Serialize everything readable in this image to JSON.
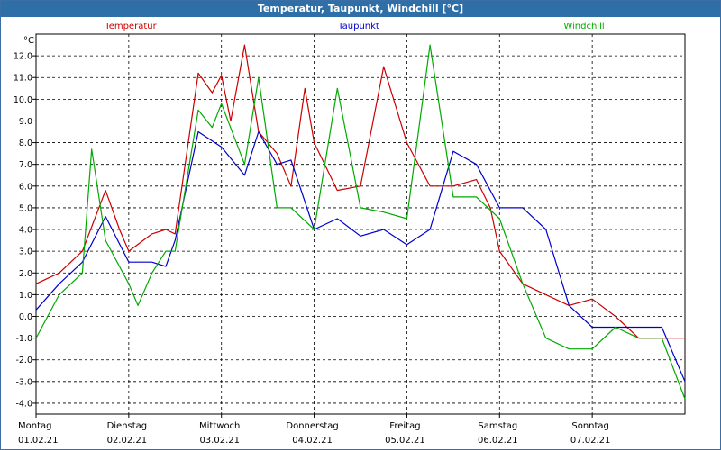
{
  "window": {
    "title": "Temperatur, Taupunkt, Windchill [°C]"
  },
  "chart_data": {
    "type": "line",
    "title": "Temperatur, Taupunkt, Windchill [°C]",
    "ylabel": "°C",
    "xlabel": "",
    "ylim": [
      -4.5,
      13.0
    ],
    "yticks": [
      -4.0,
      -3.0,
      -2.0,
      -1.0,
      0.0,
      1.0,
      2.0,
      3.0,
      4.0,
      5.0,
      6.0,
      7.0,
      8.0,
      9.0,
      10.0,
      11.0,
      12.0
    ],
    "ytick_labels": [
      "-4.0",
      "-3.0",
      "-2.0",
      "-1.0",
      "0.0",
      "1.0",
      "2.0",
      "3.0",
      "4.0",
      "5.0",
      "6.0",
      "7.0",
      "8.0",
      "9.0",
      "10.0",
      "11.0",
      "12.0"
    ],
    "grid": true,
    "x_range_days": [
      0,
      7
    ],
    "day_labels": [
      {
        "day": "Montag",
        "date": "01.02.21"
      },
      {
        "day": "Dienstag",
        "date": "02.02.21"
      },
      {
        "day": "Mittwoch",
        "date": "03.02.21"
      },
      {
        "day": "Donnerstag",
        "date": "04.02.21"
      },
      {
        "day": "Freitag",
        "date": "05.02.21"
      },
      {
        "day": "Samstag",
        "date": "06.02.21"
      },
      {
        "day": "Sonntag",
        "date": "07.02.21"
      }
    ],
    "legend_placement": "top",
    "series": [
      {
        "name": "Temperatur",
        "color": "#cc0000",
        "x": [
          0,
          0.25,
          0.5,
          0.75,
          0.9,
          1.0,
          1.25,
          1.4,
          1.5,
          1.75,
          1.9,
          2.0,
          2.1,
          2.25,
          2.4,
          2.6,
          2.75,
          2.9,
          3.0,
          3.25,
          3.5,
          3.75,
          4.0,
          4.25,
          4.5,
          4.75,
          4.9,
          5.0,
          5.25,
          5.5,
          5.75,
          6.0,
          6.25,
          6.5,
          6.75,
          7.0
        ],
        "values": [
          1.5,
          2.0,
          3.0,
          5.8,
          4.0,
          3.0,
          3.8,
          4.0,
          3.8,
          11.2,
          10.3,
          11.1,
          9.0,
          12.5,
          8.5,
          7.5,
          6.0,
          10.5,
          8.0,
          5.8,
          6.0,
          11.5,
          8.0,
          6.0,
          6.0,
          6.3,
          5.0,
          3.0,
          1.5,
          1.0,
          0.5,
          0.8,
          0.0,
          -1.0,
          -1.0,
          -1.0
        ]
      },
      {
        "name": "Taupunkt",
        "color": "#0000cc",
        "x": [
          0,
          0.25,
          0.5,
          0.75,
          1.0,
          1.25,
          1.4,
          1.5,
          1.75,
          2.0,
          2.25,
          2.4,
          2.6,
          2.75,
          3.0,
          3.25,
          3.5,
          3.75,
          4.0,
          4.25,
          4.5,
          4.75,
          5.0,
          5.25,
          5.5,
          5.75,
          6.0,
          6.25,
          6.5,
          6.75,
          7.0
        ],
        "values": [
          0.3,
          1.5,
          2.5,
          4.6,
          2.5,
          2.5,
          2.3,
          3.5,
          8.5,
          7.8,
          6.5,
          8.5,
          7.0,
          7.2,
          4.0,
          4.5,
          3.7,
          4.0,
          3.3,
          4.0,
          7.6,
          7.0,
          5.0,
          5.0,
          4.0,
          0.5,
          -0.5,
          -0.5,
          -0.5,
          -0.5,
          -3.0
        ]
      },
      {
        "name": "Windchill",
        "color": "#00aa00",
        "x": [
          0,
          0.25,
          0.5,
          0.6,
          0.75,
          1.0,
          1.1,
          1.25,
          1.4,
          1.5,
          1.75,
          1.9,
          2.0,
          2.25,
          2.4,
          2.6,
          2.75,
          3.0,
          3.25,
          3.5,
          3.75,
          4.0,
          4.25,
          4.5,
          4.75,
          5.0,
          5.25,
          5.5,
          5.75,
          6.0,
          6.25,
          6.5,
          6.75,
          7.0
        ],
        "values": [
          -1.0,
          1.0,
          2.0,
          7.7,
          3.5,
          1.5,
          0.5,
          2.0,
          3.0,
          3.0,
          9.5,
          8.7,
          9.8,
          7.0,
          11.0,
          5.0,
          5.0,
          4.0,
          10.5,
          5.0,
          4.8,
          4.5,
          12.5,
          5.5,
          5.5,
          4.5,
          1.5,
          -1.0,
          -1.5,
          -1.5,
          -0.5,
          -1.0,
          -1.0,
          -3.8
        ]
      }
    ]
  }
}
